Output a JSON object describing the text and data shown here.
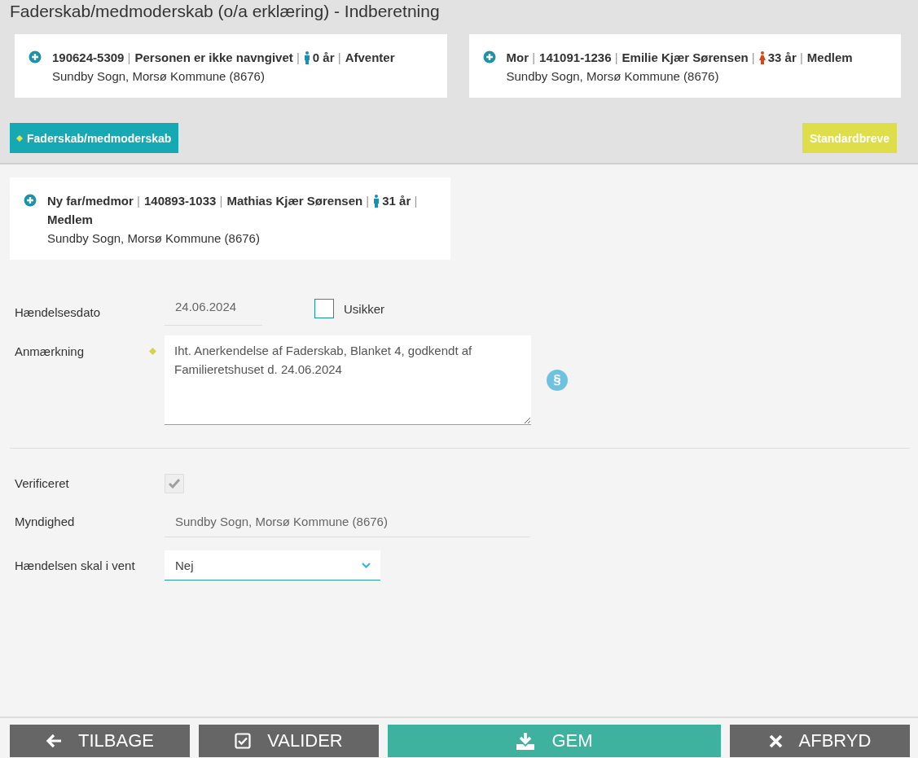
{
  "window": {
    "title": "Faderskab/medmoderskab (o/a erklæring) - Indberetning"
  },
  "header_cards": [
    {
      "parts": [
        {
          "text": "**190624-5309** |"
        },
        {
          "text": "**Personen er ikke navngivet** |"
        },
        {
          "text": "**0 år** |",
          "female_icon": false
        },
        {
          "text": "**Afventer**"
        }
      ],
      "address": "Sundby Sogn, Morsø Kommune (8676)"
    },
    {
      "parts": [
        {
          "text": "**Mor** |"
        },
        {
          "text": "**141091-1236** |"
        },
        {
          "text": "**Emilie Kjær Sørensen** |"
        },
        {
          "text": "**33 år** |",
          "female_icon": true
        },
        {
          "text": "**Medlem**"
        }
      ],
      "address": "Sundby Sogn, Morsø Kommune (8676)"
    }
  ],
  "toolbar": {
    "tab_label": "Faderskab/medmoderskab",
    "letters_button": "Standardbreve"
  },
  "new_parent_card": {
    "parts": [
      {
        "text": "**Ny far/medmor** |"
      },
      {
        "text": "**140893-1033** |"
      },
      {
        "text": "**Mathias Kjær Sørensen** |"
      },
      {
        "text": "**31 år** |",
        "female_icon": false
      },
      {
        "text": "**Medlem**"
      }
    ],
    "address": "Sundby Sogn, Morsø Kommune (8676)"
  },
  "form": {
    "rows": [
      {
        "kind": "date",
        "label": "Hændelsesdato",
        "value": "24.06.2024",
        "checkbox": {
          "label": "Usikker",
          "checked": false
        }
      },
      {
        "kind": "textarea",
        "label": "Anmærkning",
        "required": true,
        "side_button": "§",
        "value": "Iht. Anerkendelse af Faderskab, Blanket 4, godkendt af Familieretshuset d. 24.06.2024"
      },
      {
        "kind": "divider"
      },
      {
        "kind": "checkbox",
        "label": "Verificeret",
        "checked": true,
        "disabled": true
      },
      {
        "kind": "readonly",
        "label": "Myndighed",
        "value": "Sundby Sogn, Morsø Kommune (8676)"
      },
      {
        "kind": "select",
        "label": "Hændelsen skal i vent",
        "value": "Nej"
      }
    ]
  },
  "footer_buttons": [
    {
      "kind": "back",
      "label": "TILBAGE",
      "primary": false
    },
    {
      "kind": "validate",
      "label": "VALIDER",
      "primary": false
    },
    {
      "kind": "save",
      "label": "GEM",
      "primary": true
    },
    {
      "kind": "cancel",
      "label": "AFBRYD",
      "primary": false
    }
  ]
}
